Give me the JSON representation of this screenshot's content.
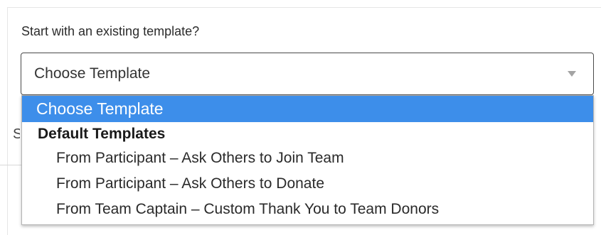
{
  "form": {
    "label": "Start with an existing template?",
    "select": {
      "value": "Choose Template"
    }
  },
  "dropdown": {
    "selected_option": "Choose Template",
    "group": {
      "label": "Default Templates",
      "options": [
        "From Participant – Ask Others to Join Team",
        "From Participant – Ask Others to Donate",
        "From Team Captain – Custom Thank You to Team Donors"
      ]
    }
  },
  "background": {
    "partial_text": "S"
  }
}
